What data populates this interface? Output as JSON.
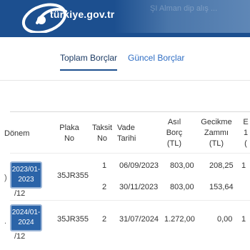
{
  "header": {
    "logo_text": "türkiye.gov.tr",
    "ghost_text": "ŞI Alman dip alış ..."
  },
  "tabs": [
    {
      "label": "Toplam Borçlar",
      "active": true
    },
    {
      "label": "Güncel Borçlar",
      "active": false
    }
  ],
  "table": {
    "headers": {
      "donem": "Dönem",
      "plaka": [
        "Plaka",
        "No"
      ],
      "taksit": [
        "Taksit",
        "No"
      ],
      "vade": [
        "Vade",
        "Tarihi"
      ],
      "asil": [
        "Asıl",
        "Borç",
        "(TL)"
      ],
      "gecikme": [
        "Gecikme",
        "Zammı",
        "(TL)"
      ],
      "extra": [
        "E",
        "1",
        "("
      ]
    },
    "rows": [
      {
        "period_top": "2023/01-",
        "period_bottom": "2023",
        "plaka": "35JR355",
        "suffix": "/12",
        "taksit": "1",
        "vade": "06/09/2023",
        "asil": "803,00",
        "gecikme": "208,25",
        "extra": "1"
      },
      {
        "taksit": "2",
        "vade": "30/11/2023",
        "asil": "803,00",
        "gecikme": "153,64"
      },
      {
        "period_top": "2024/01-",
        "period_bottom": "2024",
        "plaka": "35JR355",
        "suffix": "/12",
        "taksit": "2",
        "vade": "31/07/2024",
        "asil": "1.272,00",
        "gecikme": "0,00",
        "extra": "1"
      }
    ]
  },
  "colors": {
    "brand": "#1c4f8f",
    "accent_link": "#2f6ec4",
    "period_button": "#2b64a8"
  }
}
